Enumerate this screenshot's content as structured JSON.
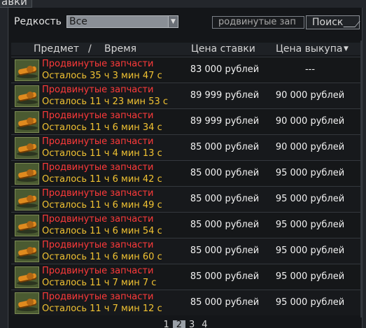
{
  "window": {
    "title_fragment": "авки"
  },
  "filter": {
    "rarity_label": "Редкость",
    "rarity_value": "Все",
    "search_value": "родвинутые зап",
    "search_button": "Поиск"
  },
  "table": {
    "headers": {
      "item": "Предмет",
      "separator": "/",
      "time": "Время",
      "bid": "Цена ставки",
      "buyout": "Цена выкупа",
      "sort_arrow": "▼"
    },
    "rows": [
      {
        "name": "Продвинутые запчасти",
        "remaining": "Осталось 35 ч 3 мин 47 с",
        "bid": "83 000 рублей",
        "buyout": "---"
      },
      {
        "name": "Продвинутые запчасти",
        "remaining": "Осталось 11 ч 23 мин 53 с",
        "bid": "89 999 рублей",
        "buyout": "90 000 рублей"
      },
      {
        "name": "Продвинутые запчасти",
        "remaining": "Осталось 11 ч 6 мин 34 с",
        "bid": "89 999 рублей",
        "buyout": "90 000 рублей"
      },
      {
        "name": "Продвинутые запчасти",
        "remaining": "Осталось 11 ч 4 мин 13 с",
        "bid": "85 000 рублей",
        "buyout": "90 000 рублей"
      },
      {
        "name": "Продвинутые запчасти",
        "remaining": "Осталось 11 ч 6 мин 42 с",
        "bid": "85 000 рублей",
        "buyout": "95 000 рублей"
      },
      {
        "name": "Продвинутые запчасти",
        "remaining": "Осталось 11 ч 6 мин 49 с",
        "bid": "85 000 рублей",
        "buyout": "95 000 рублей"
      },
      {
        "name": "Продвинутые запчасти",
        "remaining": "Осталось 11 ч 6 мин 54 с",
        "bid": "85 000 рублей",
        "buyout": "95 000 рублей"
      },
      {
        "name": "Продвинутые запчасти",
        "remaining": "Осталось 11 ч 6 мин 60 с",
        "bid": "85 000 рублей",
        "buyout": "95 000 рублей"
      },
      {
        "name": "Продвинутые запчасти",
        "remaining": "Осталось 11 ч 7 мин 7 с",
        "bid": "85 000 рублей",
        "buyout": "95 000 рублей"
      },
      {
        "name": "Продвинутые запчасти",
        "remaining": "Осталось 11 ч 7 мин 12 с",
        "bid": "85 000 рублей",
        "buyout": "95 000 рублей"
      }
    ]
  },
  "pagination": {
    "pages": [
      "1",
      "2",
      "3",
      "4"
    ],
    "current": "2"
  },
  "colors": {
    "item_name": "#ff3a3a",
    "remaining_time": "#f1c232",
    "background": "#141619"
  },
  "icons": {
    "item_thumbnail": "advanced-parts-icon",
    "rarity_dropdown": "chevron-down-icon"
  }
}
